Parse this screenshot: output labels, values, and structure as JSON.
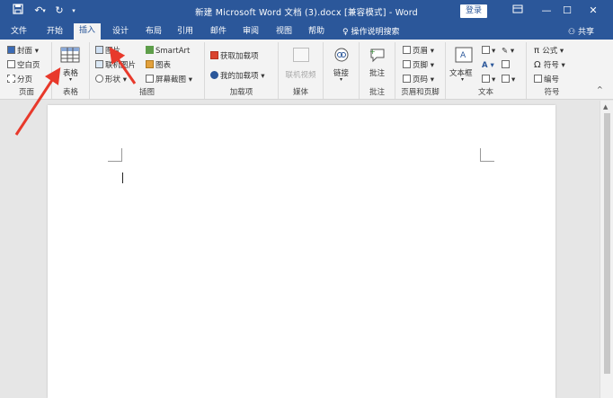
{
  "window": {
    "title": "新建 Microsoft Word 文档 (3).docx [兼容模式] - Word",
    "login_label": "登录",
    "quick_access": {
      "save_icon": "save-icon",
      "undo_icon": "undo-icon",
      "redo_icon": "redo-icon",
      "customize_icon": "customize-icon"
    },
    "controls": {
      "ribbon_options": "ribbon-display-icon",
      "minimize": "minimize-icon",
      "maximize": "maximize-icon",
      "close": "close-icon"
    }
  },
  "tabs": [
    {
      "label": "文件"
    },
    {
      "label": "开始"
    },
    {
      "label": "插入",
      "active": true
    },
    {
      "label": "设计"
    },
    {
      "label": "布局"
    },
    {
      "label": "引用"
    },
    {
      "label": "邮件"
    },
    {
      "label": "审阅"
    },
    {
      "label": "视图"
    },
    {
      "label": "帮助"
    }
  ],
  "tell_me": "操作说明搜索",
  "share": "共享",
  "ribbon": {
    "pages": {
      "label": "页面",
      "items": [
        "封面",
        "空白页",
        "分页"
      ]
    },
    "tables": {
      "label": "表格",
      "button": "表格"
    },
    "illustrations": {
      "label": "插图",
      "items": [
        "图片",
        "联机图片",
        "形状",
        "SmartArt",
        "图表",
        "屏幕截图"
      ]
    },
    "addins": {
      "label": "加载项",
      "items": [
        "获取加载项",
        "我的加载项"
      ]
    },
    "media": {
      "label": "媒体",
      "button": "联机视频"
    },
    "links": {
      "label": "",
      "button": "链接"
    },
    "comments": {
      "label": "批注",
      "button": "批注"
    },
    "header_footer": {
      "label": "页眉和页脚",
      "items": [
        "页眉",
        "页脚",
        "页码"
      ]
    },
    "text": {
      "label": "文本",
      "button": "文本框"
    },
    "symbols": {
      "label": "符号",
      "items": [
        "公式",
        "符号",
        "编号"
      ]
    }
  },
  "colors": {
    "title_bar": "#2b579a",
    "ribbon_bg": "#f3f3f3",
    "annotation_arrow": "#e8392b"
  }
}
